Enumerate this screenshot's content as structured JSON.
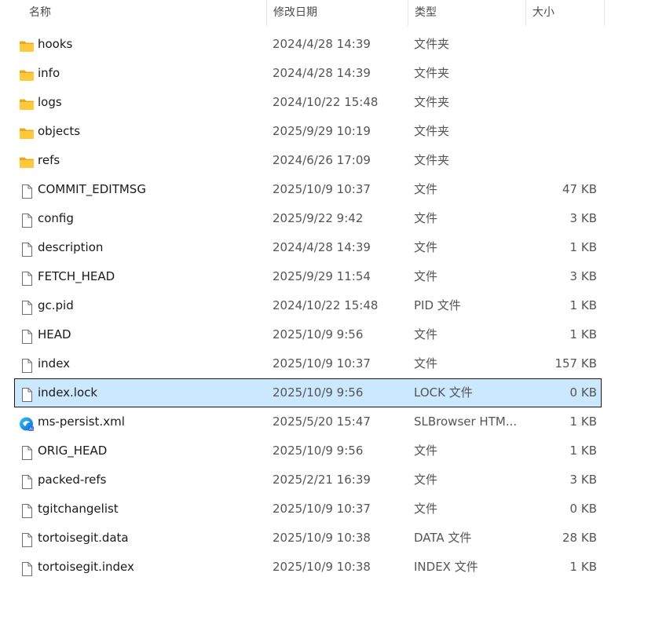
{
  "header": {
    "name": "名称",
    "date": "修改日期",
    "type": "类型",
    "size": "大小",
    "sort_indicator": "^"
  },
  "files": [
    {
      "name": "hooks",
      "date": "2024/4/28 14:39",
      "type": "文件夹",
      "size": "",
      "icon": "folder-icon"
    },
    {
      "name": "info",
      "date": "2024/4/28 14:39",
      "type": "文件夹",
      "size": "",
      "icon": "folder-icon"
    },
    {
      "name": "logs",
      "date": "2024/10/22 15:48",
      "type": "文件夹",
      "size": "",
      "icon": "folder-icon"
    },
    {
      "name": "objects",
      "date": "2025/9/29 10:19",
      "type": "文件夹",
      "size": "",
      "icon": "folder-icon"
    },
    {
      "name": "refs",
      "date": "2024/6/26 17:09",
      "type": "文件夹",
      "size": "",
      "icon": "folder-icon"
    },
    {
      "name": "COMMIT_EDITMSG",
      "date": "2025/10/9 10:37",
      "type": "文件",
      "size": "47 KB",
      "icon": "file-icon"
    },
    {
      "name": "config",
      "date": "2025/9/22 9:42",
      "type": "文件",
      "size": "3 KB",
      "icon": "file-icon"
    },
    {
      "name": "description",
      "date": "2024/4/28 14:39",
      "type": "文件",
      "size": "1 KB",
      "icon": "file-icon"
    },
    {
      "name": "FETCH_HEAD",
      "date": "2025/9/29 11:54",
      "type": "文件",
      "size": "3 KB",
      "icon": "file-icon"
    },
    {
      "name": "gc.pid",
      "date": "2024/10/22 15:48",
      "type": "PID 文件",
      "size": "1 KB",
      "icon": "file-icon"
    },
    {
      "name": "HEAD",
      "date": "2025/10/9 9:56",
      "type": "文件",
      "size": "1 KB",
      "icon": "file-icon"
    },
    {
      "name": "index",
      "date": "2025/10/9 10:37",
      "type": "文件",
      "size": "157 KB",
      "icon": "file-icon"
    },
    {
      "name": "index.lock",
      "date": "2025/10/9 9:56",
      "type": "LOCK 文件",
      "size": "0 KB",
      "icon": "file-icon",
      "selected": true
    },
    {
      "name": "ms-persist.xml",
      "date": "2025/5/20 15:47",
      "type": "SLBrowser HTM...",
      "size": "1 KB",
      "icon": "browser-icon"
    },
    {
      "name": "ORIG_HEAD",
      "date": "2025/10/9 9:56",
      "type": "文件",
      "size": "1 KB",
      "icon": "file-icon"
    },
    {
      "name": "packed-refs",
      "date": "2025/2/21 16:39",
      "type": "文件",
      "size": "3 KB",
      "icon": "file-icon"
    },
    {
      "name": "tgitchangelist",
      "date": "2025/10/9 10:37",
      "type": "文件",
      "size": "0 KB",
      "icon": "file-icon"
    },
    {
      "name": "tortoisegit.data",
      "date": "2025/10/9 10:38",
      "type": "DATA 文件",
      "size": "28 KB",
      "icon": "file-icon"
    },
    {
      "name": "tortoisegit.index",
      "date": "2025/10/9 10:38",
      "type": "INDEX 文件",
      "size": "1 KB",
      "icon": "file-icon"
    }
  ],
  "colors": {
    "selected_bg": "#cce8ff",
    "folder_yellow": "#ffc83d"
  }
}
